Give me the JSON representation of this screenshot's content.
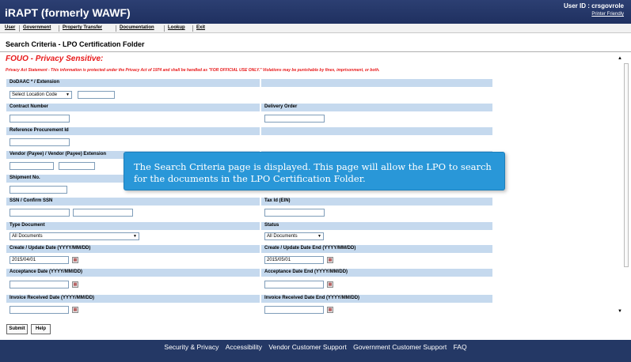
{
  "app": {
    "title": "iRAPT (formerly WAWF)",
    "user_id": "User ID : crsgovrole",
    "printer_friendly": "Printer Friendly"
  },
  "menu": [
    "User",
    "Government",
    "Property Transfer",
    "Documentation",
    "Lookup",
    "Exit"
  ],
  "page_title": "Search Criteria - LPO Certification Folder",
  "fouo": "FOUO - Privacy Sensitive:",
  "privacy_statement": "Privacy Act Statement - This information is protected under the Privacy Act of 1974 and shall be handled as \"FOR OFFICIAL USE ONLY.\" Violations may be punishable by fines, imprisonment, or both.",
  "fields": {
    "dodaac_label": "DoDAAC * / Extension",
    "location_select": "Select Location Code",
    "contract_label": "Contract Number",
    "delivery_label": "Delivery Order",
    "reference_label": "Reference Procurement Id",
    "vendor_label": "Vendor (Payee) / Vendor (Payee) Extension",
    "shipment_label": "Shipment No.",
    "ssn_label": "SSN / Confirm SSN",
    "taxid_label": "Tax Id (EIN)",
    "type_label": "Type Document",
    "type_value": "All Documents",
    "status_label": "Status",
    "status_value": "All Documents",
    "create_label": "Create / Update Date (YYYY/MM/DD)",
    "create_value": "2015/04/01",
    "create_end_label": "Create / Update Date End (YYYY/MM/DD)",
    "create_end_value": "2015/05/01",
    "accept_label": "Acceptance Date (YYYY/MM/DD)",
    "accept_end_label": "Acceptance Date End (YYYY/MM/DD)",
    "invoice_label": "Invoice Received Date (YYYY/MM/DD)",
    "invoice_end_label": "Invoice Received Date End (YYYY/MM/DD)"
  },
  "buttons": {
    "submit": "Submit",
    "help": "Help"
  },
  "callout": "The Search Criteria page is displayed.  This page will allow the LPO to search for the documents in the LPO Certification Folder.",
  "footer": [
    "Security & Privacy",
    "Accessibility",
    "Vendor Customer Support",
    "Government Customer Support",
    "FAQ"
  ],
  "colors": {
    "header": "#243865",
    "label_bar": "#c5d9ee",
    "warning": "#e8191a",
    "callout": "#2997d8"
  }
}
